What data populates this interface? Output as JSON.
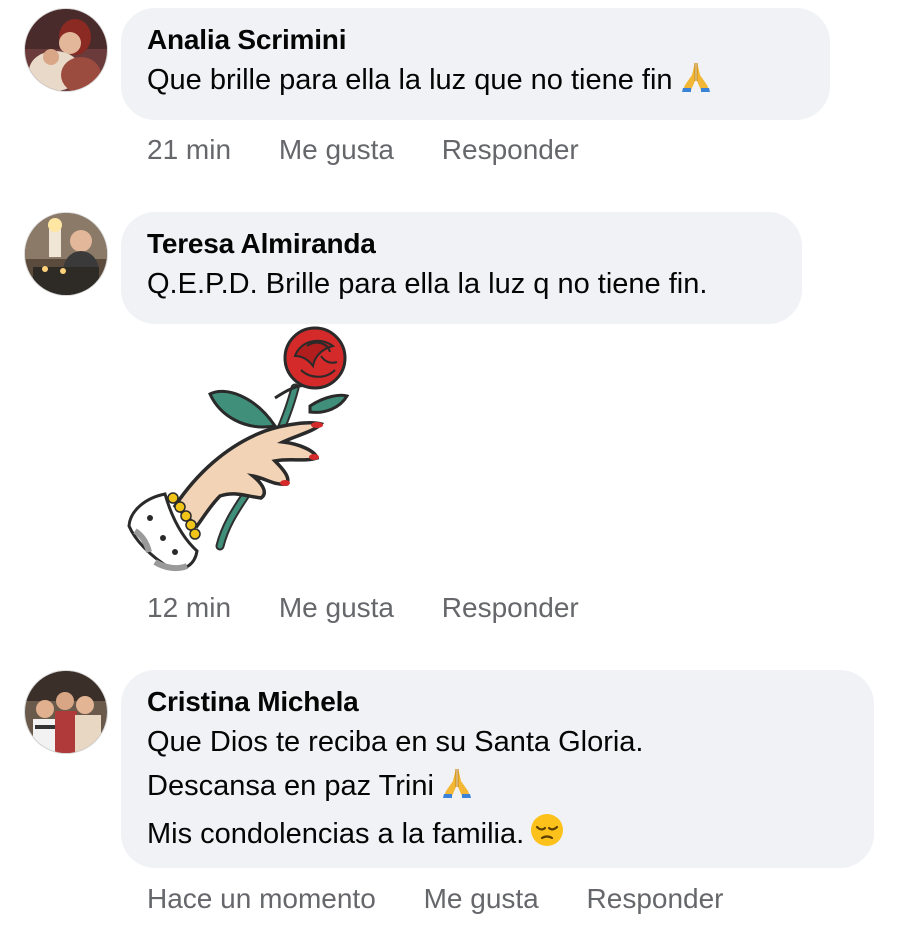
{
  "comments": [
    {
      "author": "Analia Scrimini",
      "lines": [
        "Que brille para ella la luz que no tiene fin"
      ],
      "time": "21 min",
      "like_label": "Me gusta",
      "reply_label": "Responder",
      "avatar_icon": "avatar-photo-woman",
      "emoji": "folded-hands-icon"
    },
    {
      "author": "Teresa Almiranda",
      "lines": [
        "Q.E.P.D. Brille para ella la luz q no tiene fin."
      ],
      "time": "12 min",
      "like_label": "Me gusta",
      "reply_label": "Responder",
      "avatar_icon": "avatar-photo-candles",
      "sticker": "hand-holding-rose-sticker"
    },
    {
      "author": "Cristina Michela",
      "lines": [
        "Que Dios te reciba en su Santa Gloria.",
        "Descansa en paz Trini",
        "Mis condolencias a la familia."
      ],
      "time": "Hace un momento",
      "like_label": "Me gusta",
      "reply_label": "Responder",
      "avatar_icon": "avatar-photo-children",
      "emoji_line2": "folded-hands-icon",
      "emoji_line3": "pensive-face-icon"
    }
  ],
  "colors": {
    "bubble": "#f0f2f5",
    "text": "#050505",
    "meta": "#65676b"
  }
}
